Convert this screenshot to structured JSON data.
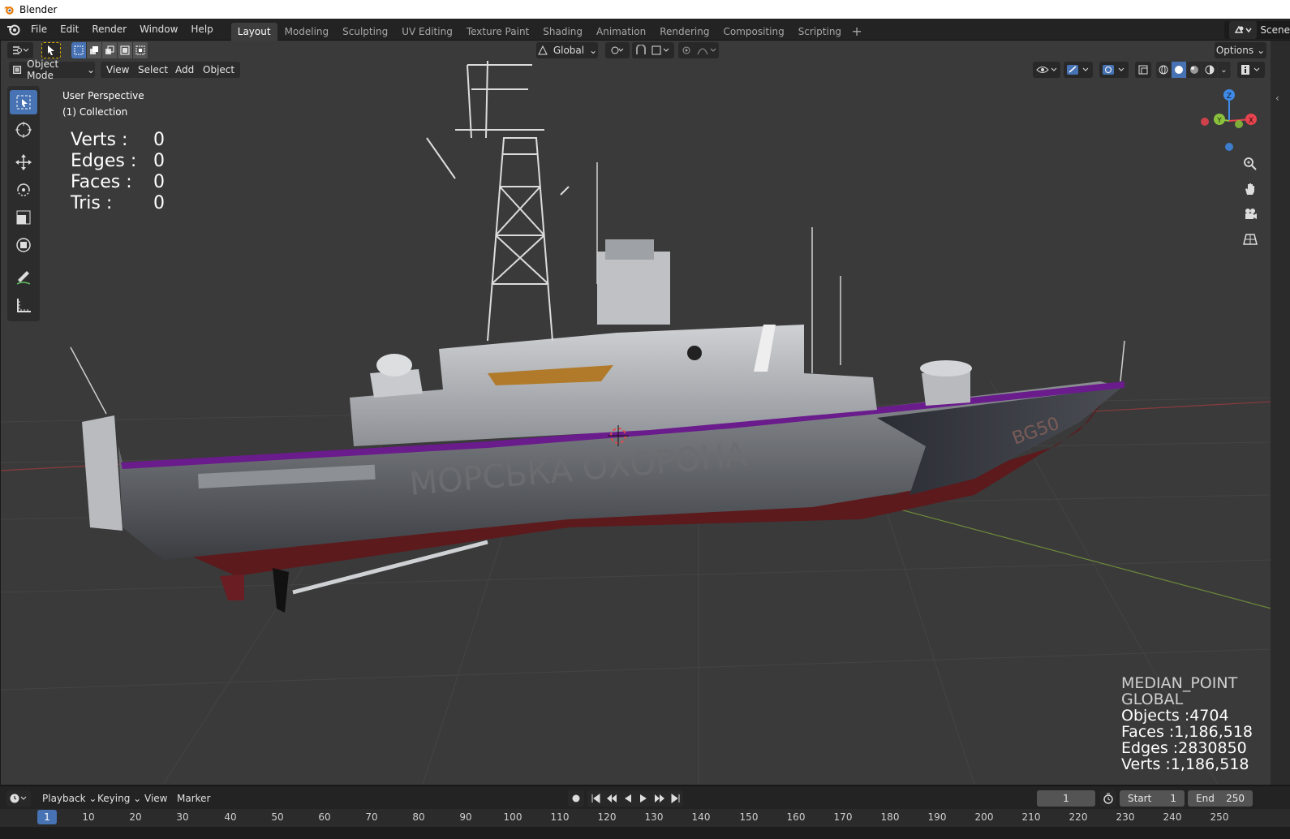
{
  "window": {
    "title": "Blender"
  },
  "topbar": {
    "menus": [
      "File",
      "Edit",
      "Render",
      "Window",
      "Help"
    ],
    "workspaces": [
      "Layout",
      "Modeling",
      "Sculpting",
      "UV Editing",
      "Texture Paint",
      "Shading",
      "Animation",
      "Rendering",
      "Compositing",
      "Scripting"
    ],
    "active_workspace": "Layout",
    "add_workspace": "+",
    "scene_label": "Scene"
  },
  "viewport_header": {
    "transform_orientation": "Global",
    "options_label": "Options",
    "mode": "Object Mode",
    "menus": [
      "View",
      "Select",
      "Add",
      "Object"
    ]
  },
  "viewport": {
    "perspective": "User Perspective",
    "collection": "(1) Collection",
    "selection_stats": [
      {
        "label": "Verts :",
        "value": "0"
      },
      {
        "label": "Edges :",
        "value": "0"
      },
      {
        "label": "Faces :",
        "value": "0"
      },
      {
        "label": "Tris :",
        "value": "0"
      }
    ],
    "scene_stats": {
      "pivot": "MEDIAN_POINT",
      "orientation": "GLOBAL",
      "objects": "Objects :4704",
      "faces": "Faces :1,186,518",
      "edges": "Edges :2830850",
      "verts": "Verts :1,186,518"
    },
    "hull_text": "МОРСЬКА ОХОРОНА",
    "bow_text": "BG50",
    "gizmo_axes": {
      "x": "X",
      "y": "Y",
      "z": "Z"
    }
  },
  "timeline": {
    "menus": [
      "Playback",
      "Keying",
      "View",
      "Marker"
    ],
    "current_frame": "1",
    "start_label": "Start",
    "start_value": "1",
    "end_label": "End",
    "end_value": "250",
    "ticks": [
      "1",
      "10",
      "20",
      "30",
      "40",
      "50",
      "60",
      "70",
      "80",
      "90",
      "100",
      "110",
      "120",
      "130",
      "140",
      "150",
      "160",
      "170",
      "180",
      "190",
      "200",
      "210",
      "220",
      "230",
      "240",
      "250"
    ]
  },
  "colors": {
    "accent": "#4772b3",
    "viewport_bg": "#3a3a3a",
    "axis_x": "#e8434f",
    "axis_y": "#8bc13c",
    "axis_z": "#3f8ae6",
    "deck_stripe": "#6a1b8c",
    "hull_lower": "#5c1a1d"
  }
}
